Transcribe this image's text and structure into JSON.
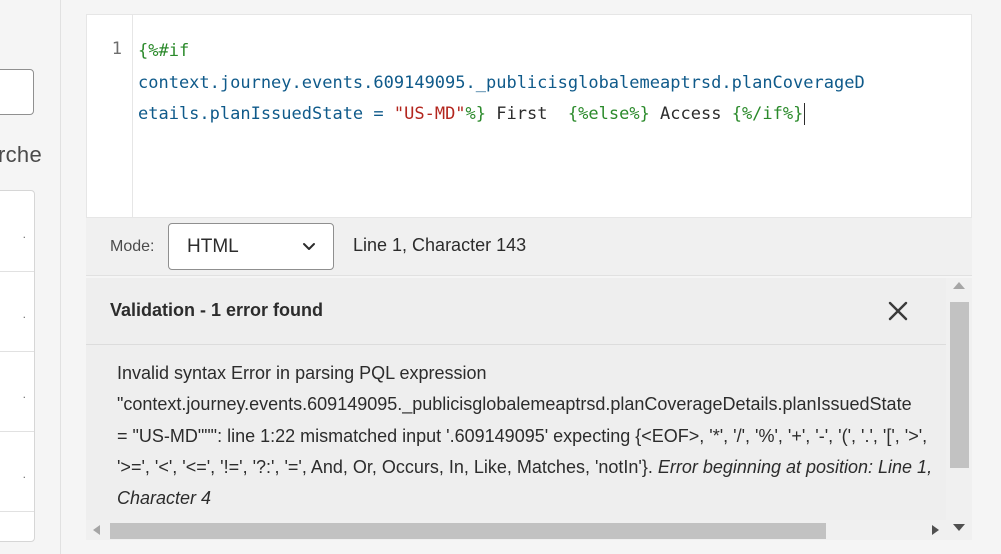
{
  "left_panel": {
    "label_fragment": "rche",
    "rows": [
      ".",
      ".",
      ".",
      "."
    ]
  },
  "editor": {
    "line_number": "1",
    "code": {
      "l1_tag": "{%#if",
      "l2_path": "context.journey.events.609149095._publicisglobalemeaptrsd.planCoverageD",
      "l3_path": "etails.planIssuedState",
      "l3_op": " = ",
      "l3_str": "\"US-MD\"",
      "l3_close": "%}",
      "l3_text1": " First  ",
      "l3_else": "{%else%}",
      "l3_text2": " Access ",
      "l3_endif": "{%/if%}"
    }
  },
  "mode_bar": {
    "label": "Mode:",
    "selected": "HTML",
    "cursor_position": "Line 1, Character 143"
  },
  "validation": {
    "title": "Validation - 1 error found",
    "lines": [
      "Invalid syntax Error in parsing PQL expression",
      "\"context.journey.events.609149095._publicisglobalemeaptrsd.planCoverageDetails.planIssuedState",
      "= \"US-MD\"\"\": line 1:22 mismatched input '.609149095' expecting {<EOF>, '*', '/', '%', '+', '-', '(', '.', '[', '>',"
    ],
    "line4_plain": "'>=', '<', '<=', '!=', '?:', '=', And, Or, Occurs, In, Like, Matches, 'notIn'}.",
    "line4_italic": " Error beginning at position: Line 1,",
    "line5_italic": "Character 4"
  },
  "colors": {
    "tag": "#2b8a2b",
    "keyword": "#8b1a8b",
    "path": "#0f5a8a",
    "string": "#b3261e"
  }
}
